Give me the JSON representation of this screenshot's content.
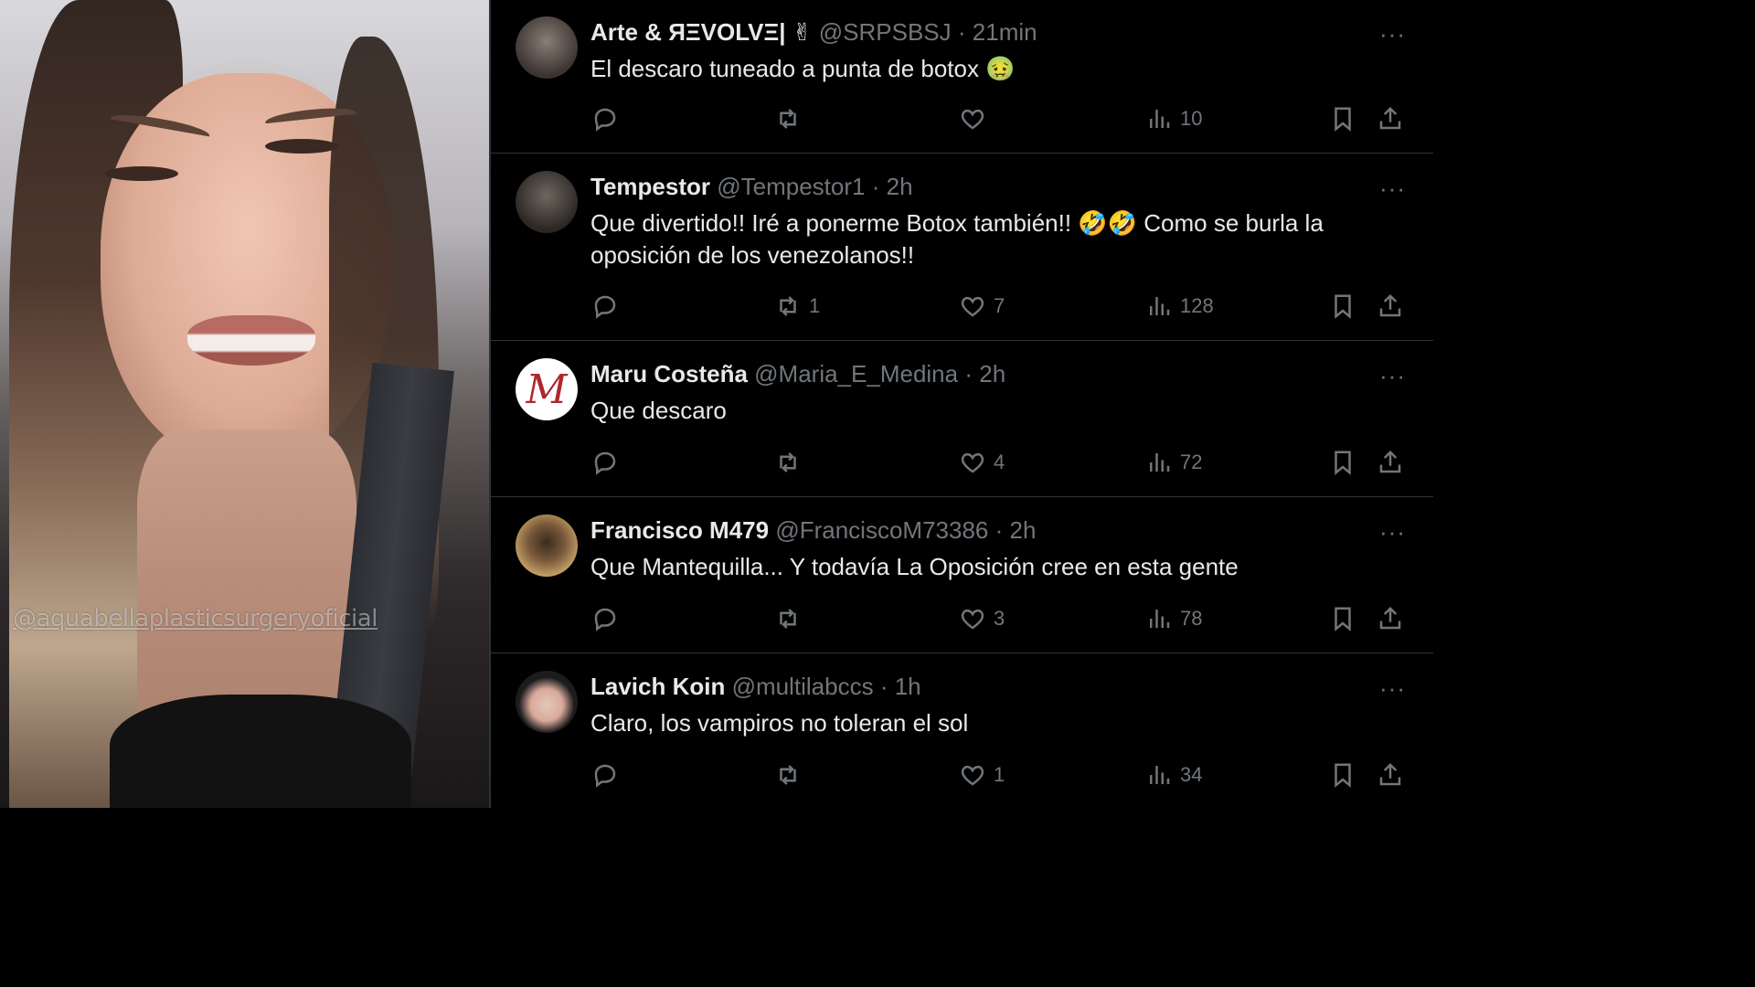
{
  "video": {
    "watermark": "@aquabellaplasticsurgeryoficial"
  },
  "replies": [
    {
      "name": "Arte & ЯΞVOLVΞ| ✌",
      "handle": "@SRPSBSJ",
      "time": "21min",
      "text": "El descaro tuneado a punta de botox 🤢",
      "reply_count": "",
      "retweet_count": "",
      "like_count": "",
      "views": "10",
      "avatar_colors": [
        "#8a7e76",
        "#3b3431"
      ]
    },
    {
      "name": "Tempestor",
      "handle": "@Tempestor1",
      "time": "2h",
      "text": "Que divertido!! Iré a ponerme Botox también!! 🤣🤣 Como se burla la oposición de los venezolanos!!",
      "reply_count": "",
      "retweet_count": "1",
      "like_count": "7",
      "views": "128",
      "avatar_colors": [
        "#6e675f",
        "#2b2724"
      ]
    },
    {
      "name": "Maru Costeña",
      "handle": "@Maria_E_Medina",
      "time": "2h",
      "text": "Que descaro",
      "reply_count": "",
      "retweet_count": "",
      "like_count": "4",
      "views": "72",
      "avatar_colors": [
        "#ffffff",
        "#b0262a"
      ]
    },
    {
      "name": "Francisco M479",
      "handle": "@FranciscoM73386",
      "time": "2h",
      "text": "Que Mantequilla... Y todavía La Oposición cree en esta gente",
      "reply_count": "",
      "retweet_count": "",
      "like_count": "3",
      "views": "78",
      "avatar_colors": [
        "#c9a46b",
        "#3a2a1e"
      ]
    },
    {
      "name": "Lavich Koin",
      "handle": "@multilabccs",
      "time": "1h",
      "text": "Claro, los vampiros no toleran el sol",
      "reply_count": "",
      "retweet_count": "",
      "like_count": "1",
      "views": "34",
      "avatar_colors": [
        "#e6c7bd",
        "#1c1c1c"
      ]
    }
  ],
  "ui": {
    "separator": "·",
    "more_glyph": "···"
  }
}
